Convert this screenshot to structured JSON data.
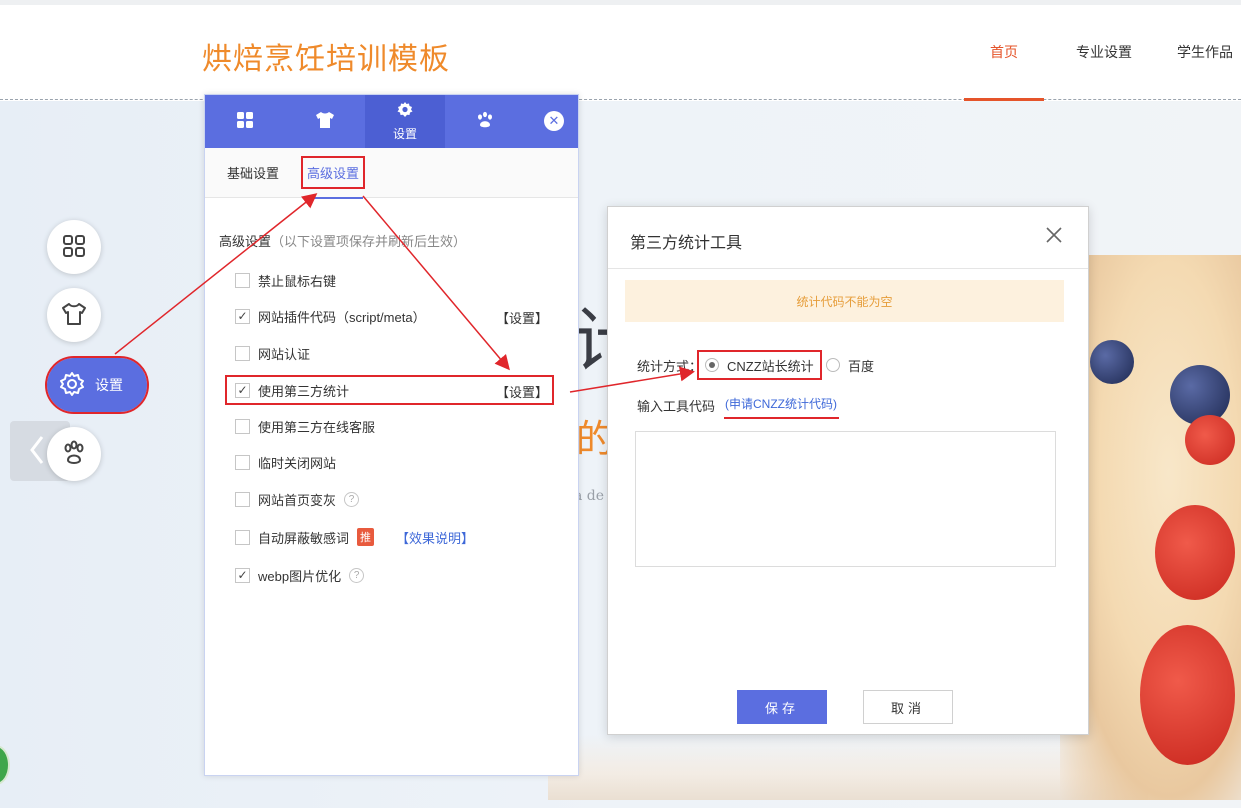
{
  "site": {
    "title": "烘焙烹饪培训模板",
    "nav": [
      "首页",
      "专业设置",
      "学生作品"
    ],
    "active_nav": 0
  },
  "hero": {
    "big_char": "计",
    "orange_text": "的",
    "small_text": "a de"
  },
  "side_tools": {
    "settings_label": "设置",
    "icons": [
      "grid-icon",
      "shirt-icon",
      "gear-icon",
      "paw-icon"
    ]
  },
  "panel": {
    "tabs": [
      {
        "icon": "grid-icon",
        "label": ""
      },
      {
        "icon": "shirt-icon",
        "label": ""
      },
      {
        "icon": "gear-icon",
        "label": "设置"
      },
      {
        "icon": "paw-icon",
        "label": ""
      }
    ],
    "subtabs": [
      "基础设置",
      "高级设置"
    ],
    "active_subtab": 1,
    "section_title": "高级设置",
    "section_note": "（以下设置项保存并刷新后生效）",
    "options": [
      {
        "label": "禁止鼠标右键",
        "checked": false
      },
      {
        "label": "网站插件代码（script/meta）",
        "checked": true,
        "action": "【设置】"
      },
      {
        "label": "网站认证",
        "checked": false
      },
      {
        "label": "使用第三方统计",
        "checked": true,
        "action": "【设置】"
      },
      {
        "label": "使用第三方在线客服",
        "checked": false
      },
      {
        "label": "临时关闭网站",
        "checked": false
      },
      {
        "label": "网站首页变灰",
        "checked": false,
        "help": "?"
      },
      {
        "label": "自动屏蔽敏感词",
        "checked": false,
        "badge": "推",
        "link": "【效果说明】"
      },
      {
        "label": "webp图片优化",
        "checked": true,
        "help": "?"
      }
    ]
  },
  "dialog": {
    "title": "第三方统计工具",
    "alert": "统计代码不能为空",
    "method_label": "统计方式：",
    "methods": [
      "CNZZ站长统计",
      "百度"
    ],
    "selected_method": 0,
    "code_label": "输入工具代码",
    "apply_link": "(申请CNZZ统计代码)",
    "code_value": "",
    "save_label": "保存",
    "cancel_label": "取消"
  },
  "colors": {
    "accent": "#5b6ee0",
    "brand_orange": "#ef8a2b",
    "annotation_red": "#e0262b"
  }
}
